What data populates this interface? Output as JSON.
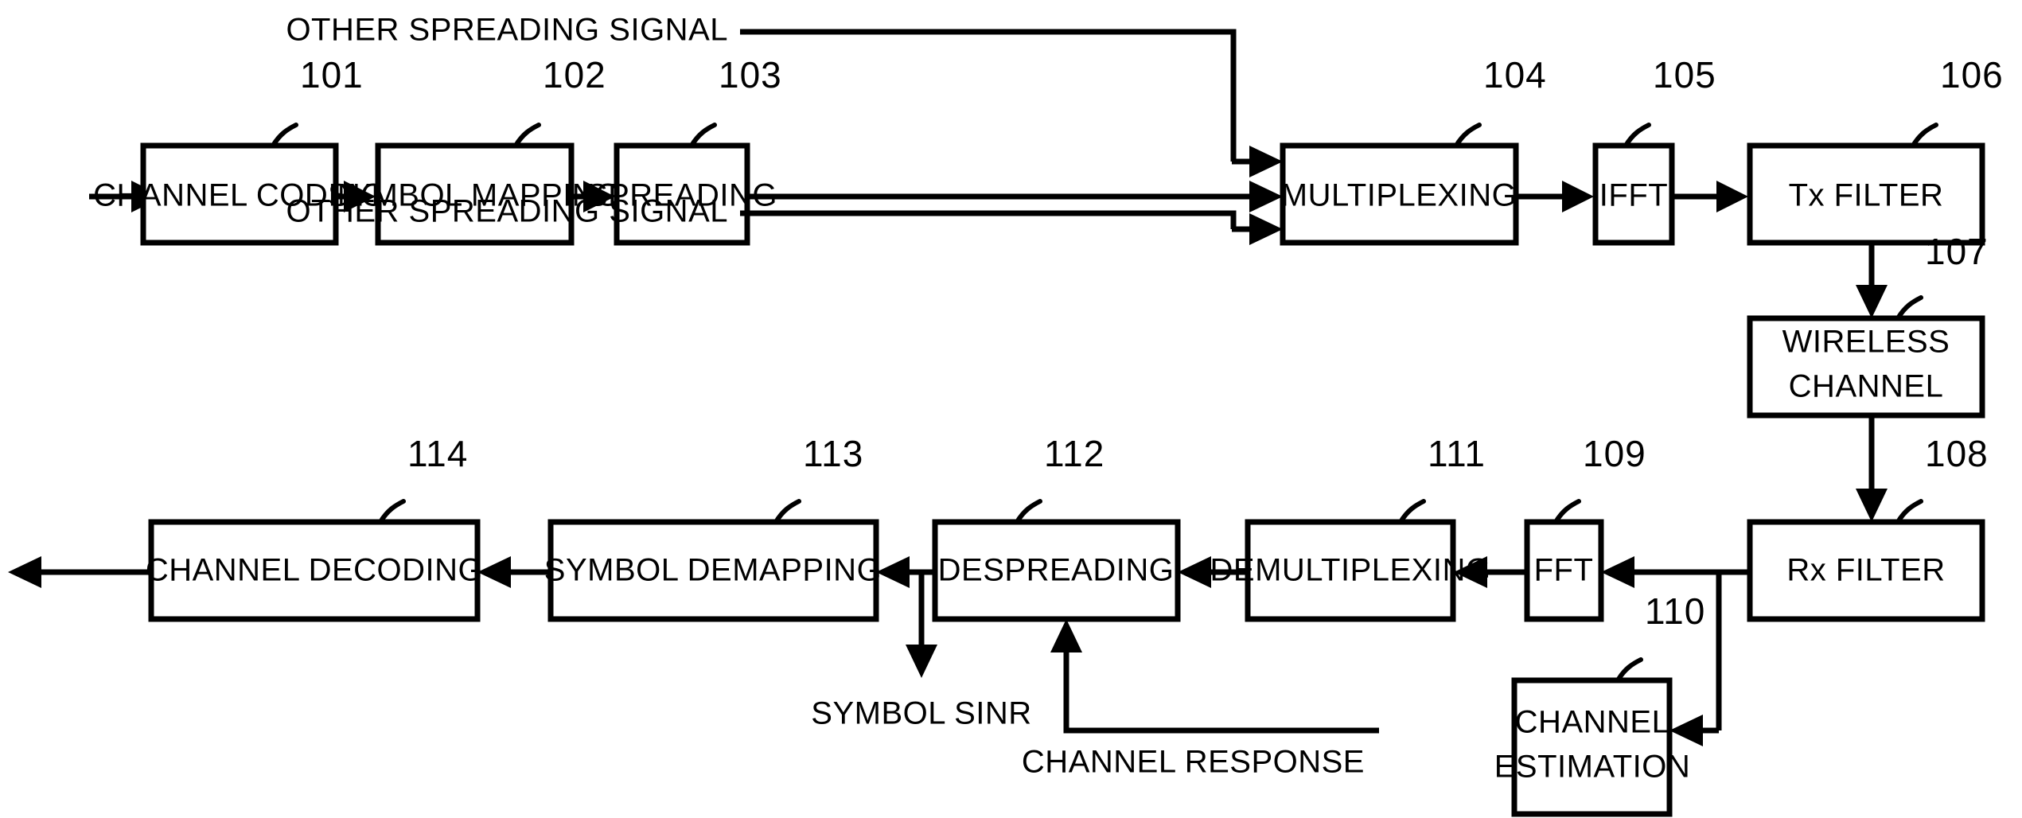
{
  "figure": {
    "type": "patent-block-diagram",
    "background_color": "#ffffff",
    "line_color": "#000000",
    "transmitter_chain": [
      {
        "ref": "101",
        "label": "CHANNEL CODING"
      },
      {
        "ref": "102",
        "label": "SYMBOL MAPPING"
      },
      {
        "ref": "103",
        "label": "SPREADING"
      },
      {
        "ref": "104",
        "label": "MULTIPLEXING"
      },
      {
        "ref": "105",
        "label": "IFFT"
      },
      {
        "ref": "106",
        "label": "Tx FILTER"
      }
    ],
    "channel": {
      "ref": "107",
      "label_line1": "WIRELESS",
      "label_line2": "CHANNEL"
    },
    "receiver_chain": [
      {
        "ref": "108",
        "label": "Rx FILTER"
      },
      {
        "ref": "109",
        "label": "FFT"
      },
      {
        "ref": "111",
        "label": "DEMULTIPLEXING"
      },
      {
        "ref": "112",
        "label": "DESPREADING"
      },
      {
        "ref": "113",
        "label": "SYMBOL DEMAPPING"
      },
      {
        "ref": "114",
        "label": "CHANNEL DECODING"
      }
    ],
    "estimator": {
      "ref": "110",
      "label_line1": "CHANNEL",
      "label_line2": "ESTIMATION"
    },
    "signal_labels": {
      "other_spreading_signal_top": "OTHER SPREADING SIGNAL",
      "other_spreading_signal_bottom": "OTHER SPREADING SIGNAL",
      "symbol_sinr": "SYMBOL SINR",
      "channel_response": "CHANNEL RESPONSE"
    }
  }
}
